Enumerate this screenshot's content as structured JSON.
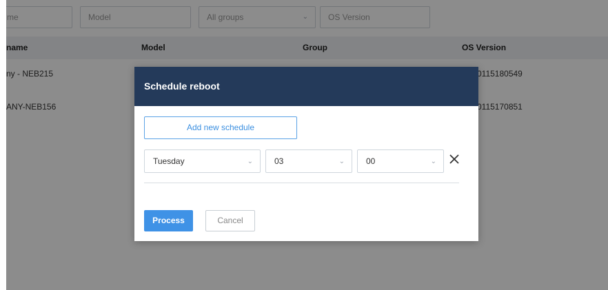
{
  "filters": {
    "name_placeholder": "me",
    "model_placeholder": "Model",
    "group_selected": "All groups",
    "os_placeholder": "OS Version"
  },
  "table": {
    "headers": {
      "name": "name",
      "model": "Model",
      "group": "Group",
      "os": "OS Version"
    },
    "rows": [
      {
        "name": "ny - NEB215",
        "os": "0115180549"
      },
      {
        "name": "ANY-NEB156",
        "os": "0115170851"
      }
    ]
  },
  "modal": {
    "title": "Schedule reboot",
    "add_schedule_label": "Add new schedule",
    "schedule": {
      "day": "Tuesday",
      "hour": "03",
      "minute": "00"
    },
    "process_label": "Process",
    "cancel_label": "Cancel"
  },
  "colors": {
    "modal_header": "#243a5a",
    "primary": "#3f92e6",
    "table_header_bg": "#eef1f4"
  },
  "icons": {
    "dropdown": "chevron-down-icon",
    "remove": "close-icon"
  }
}
